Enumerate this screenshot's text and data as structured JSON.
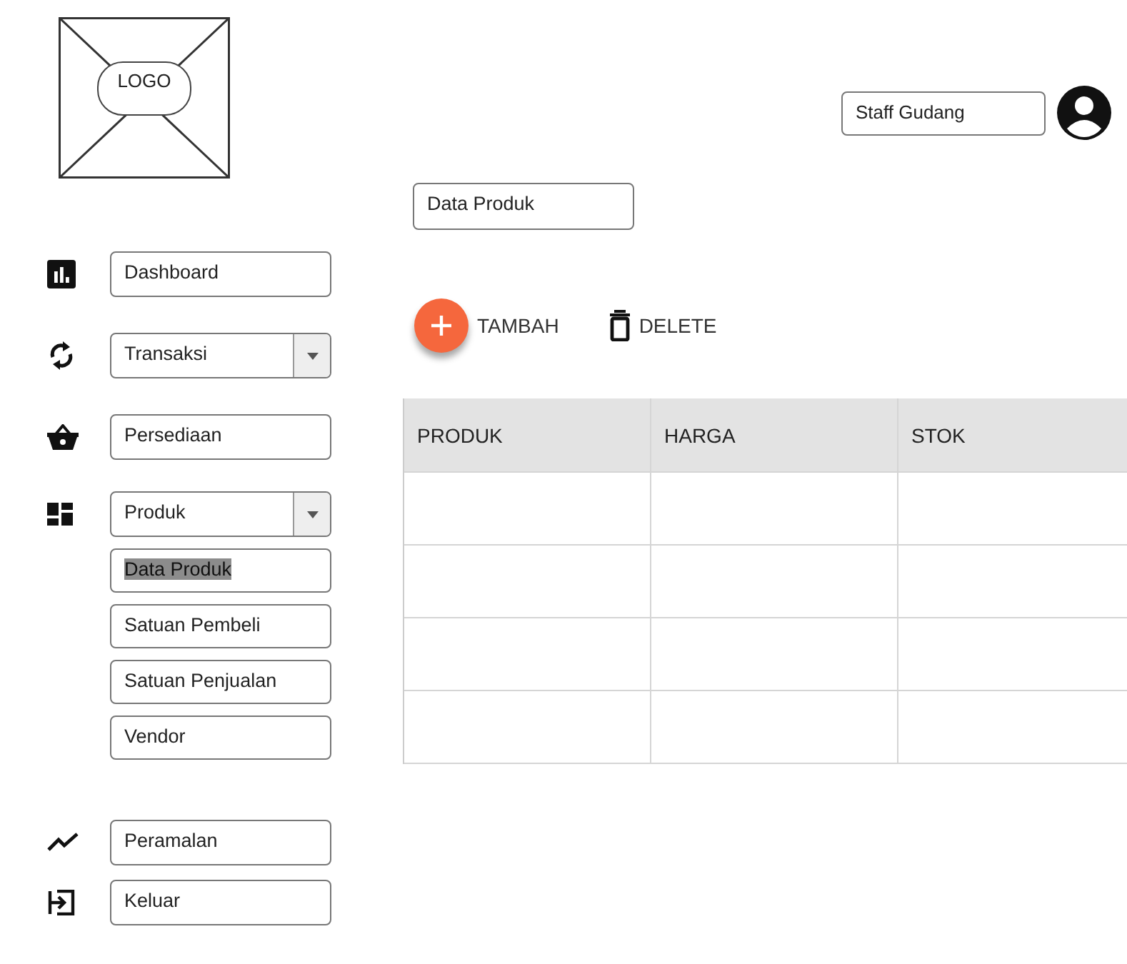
{
  "logo": {
    "label": "LOGO"
  },
  "user": {
    "role": "Staff Gudang"
  },
  "sidebar": {
    "items": [
      {
        "label": "Dashboard",
        "kind": "link"
      },
      {
        "label": "Transaksi",
        "kind": "dropdown"
      },
      {
        "label": "Persediaan",
        "kind": "link"
      },
      {
        "label": "Produk",
        "kind": "dropdown",
        "children": [
          {
            "label": "Data Produk",
            "selected": true
          },
          {
            "label": "Satuan Pembeli",
            "selected": false
          },
          {
            "label": "Satuan Penjualan",
            "selected": false
          },
          {
            "label": "Vendor",
            "selected": false
          }
        ]
      },
      {
        "label": "Peramalan",
        "kind": "link"
      },
      {
        "label": "Keluar",
        "kind": "link"
      }
    ]
  },
  "page_title": "Data Produk",
  "actions": [
    {
      "label": "TAMBAH",
      "kind": "add"
    },
    {
      "label": "DELETE",
      "kind": "delete"
    }
  ],
  "table": {
    "columns": [
      "PRODUK",
      "HARGA",
      "STOK"
    ]
  }
}
